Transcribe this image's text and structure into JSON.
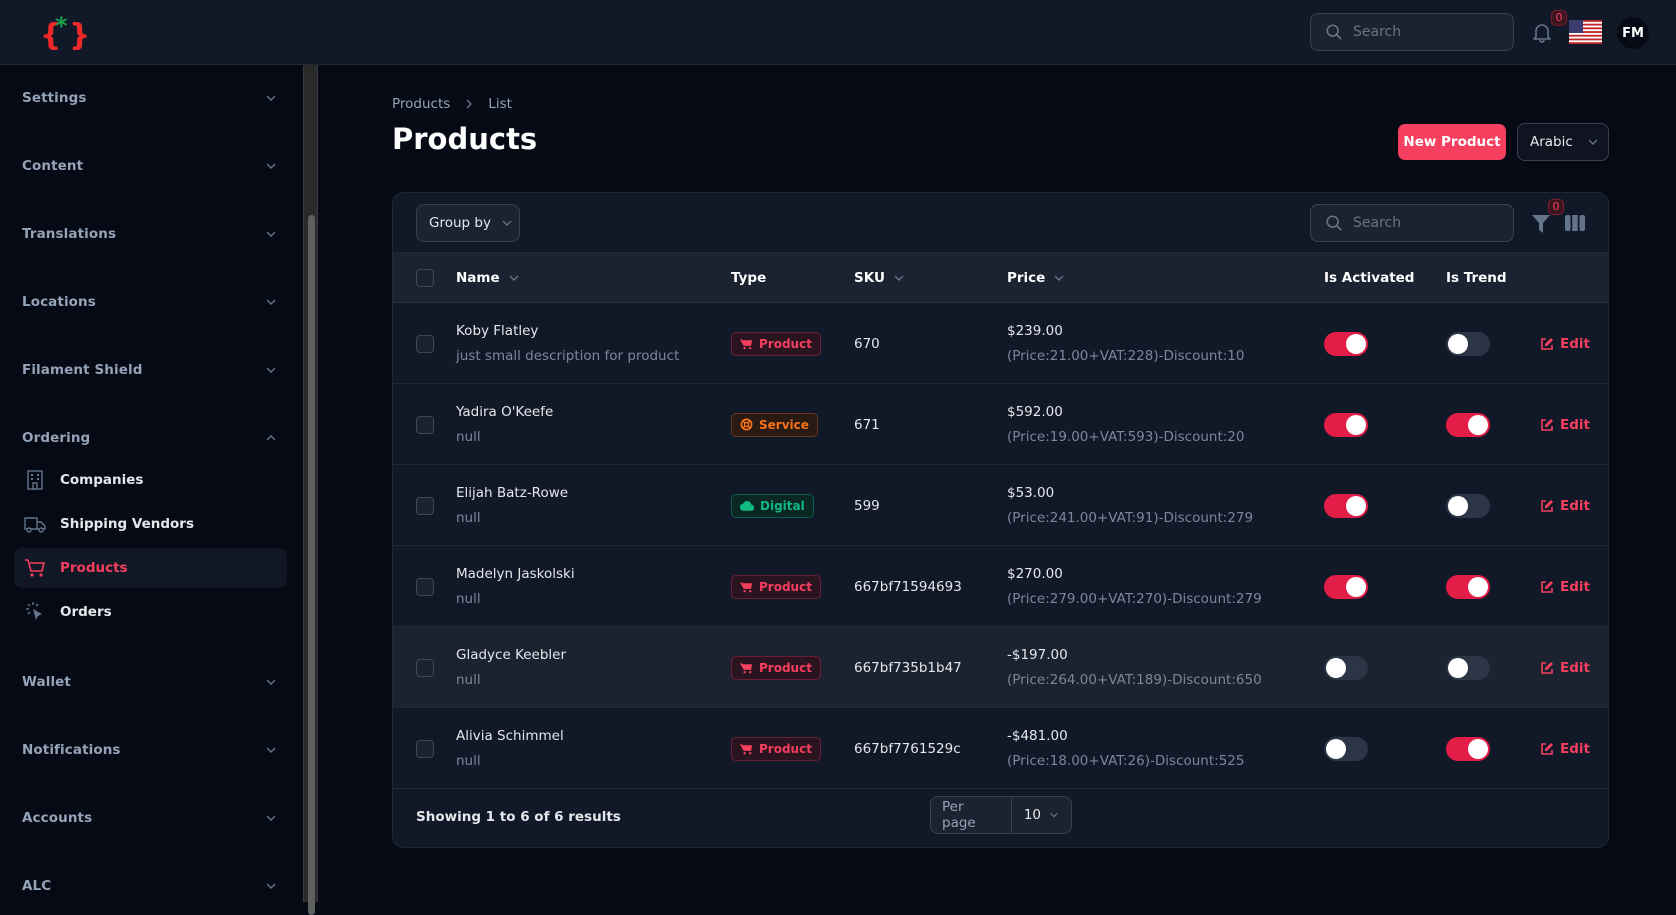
{
  "topbar": {
    "search_placeholder": "Search",
    "notifications_count": "0",
    "language_flag": "us-flag",
    "avatar_initials": "FM"
  },
  "sidebar": {
    "groups": [
      {
        "label": "Settings",
        "expanded": false
      },
      {
        "label": "Content",
        "expanded": false
      },
      {
        "label": "Translations",
        "expanded": false
      },
      {
        "label": "Locations",
        "expanded": false
      },
      {
        "label": "Filament Shield",
        "expanded": false
      },
      {
        "label": "Ordering",
        "expanded": true
      },
      {
        "label": "Wallet",
        "expanded": false
      },
      {
        "label": "Notifications",
        "expanded": false
      },
      {
        "label": "Accounts",
        "expanded": false
      },
      {
        "label": "ALC",
        "expanded": false
      }
    ],
    "ordering_items": [
      {
        "label": "Companies",
        "icon": "building-icon",
        "active": false
      },
      {
        "label": "Shipping Vendors",
        "icon": "truck-icon",
        "active": false
      },
      {
        "label": "Products",
        "icon": "cart-icon",
        "active": true
      },
      {
        "label": "Orders",
        "icon": "cursor-click-icon",
        "active": false
      }
    ]
  },
  "breadcrumb": [
    "Products",
    "List"
  ],
  "page": {
    "title": "Products",
    "new_button": "New Product",
    "language_select": "Arabic"
  },
  "table": {
    "group_by_label": "Group by",
    "search_placeholder": "Search",
    "filter_count": "0",
    "columns": {
      "name": "Name",
      "type": "Type",
      "sku": "SKU",
      "price": "Price",
      "is_activated": "Is Activated",
      "is_trend": "Is Trend"
    },
    "edit_label": "Edit",
    "rows": [
      {
        "name": "Koby Flatley",
        "description": "just small description for product",
        "type": "Product",
        "sku": "670",
        "price": "$239.00",
        "price_detail": "(Price:21.00+VAT:228)-Discount:10",
        "is_activated": true,
        "is_trend": false
      },
      {
        "name": "Yadira O'Keefe",
        "description": "null",
        "type": "Service",
        "sku": "671",
        "price": "$592.00",
        "price_detail": "(Price:19.00+VAT:593)-Discount:20",
        "is_activated": true,
        "is_trend": true
      },
      {
        "name": "Elijah Batz-Rowe",
        "description": "null",
        "type": "Digital",
        "sku": "599",
        "price": "$53.00",
        "price_detail": "(Price:241.00+VAT:91)-Discount:279",
        "is_activated": true,
        "is_trend": false
      },
      {
        "name": "Madelyn Jaskolski",
        "description": "null",
        "type": "Product",
        "sku": "667bf71594693",
        "price": "$270.00",
        "price_detail": "(Price:279.00+VAT:270)-Discount:279",
        "is_activated": true,
        "is_trend": true
      },
      {
        "name": "Gladyce Keebler",
        "description": "null",
        "type": "Product",
        "sku": "667bf735b1b47",
        "price": "-$197.00",
        "price_detail": "(Price:264.00+VAT:189)-Discount:650",
        "is_activated": false,
        "is_trend": false
      },
      {
        "name": "Alivia Schimmel",
        "description": "null",
        "type": "Product",
        "sku": "667bf7761529c",
        "price": "-$481.00",
        "price_detail": "(Price:18.00+VAT:26)-Discount:525",
        "is_activated": false,
        "is_trend": true
      }
    ],
    "footer": {
      "showing": "Showing 1 to 6 of 6 results",
      "per_page_label": "Per page",
      "per_page_value": "10"
    }
  },
  "colors": {
    "accent": "#f43f5e",
    "toggle_on": "#e11d48",
    "service": "#f97316",
    "digital": "#10b981"
  }
}
